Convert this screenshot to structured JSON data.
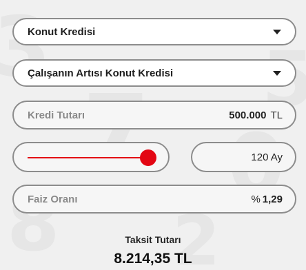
{
  "loan_type": {
    "selected": "Konut Kredisi"
  },
  "loan_product": {
    "selected": "Çalışanın Artısı Konut Kredisi"
  },
  "loan_amount": {
    "label": "Kredi Tutarı",
    "value": "500.000",
    "unit": "TL"
  },
  "term": {
    "slider_level": 0.96,
    "value": "120 Ay"
  },
  "interest_rate": {
    "label": "Faiz Oranı",
    "prefix": "%",
    "value": "1,29"
  },
  "result": {
    "label": "Taksit Tutarı",
    "value": "8.214,35 TL"
  },
  "colors": {
    "accent": "#e30613",
    "border": "#8c8c8c",
    "background": "#f0f0f0"
  }
}
